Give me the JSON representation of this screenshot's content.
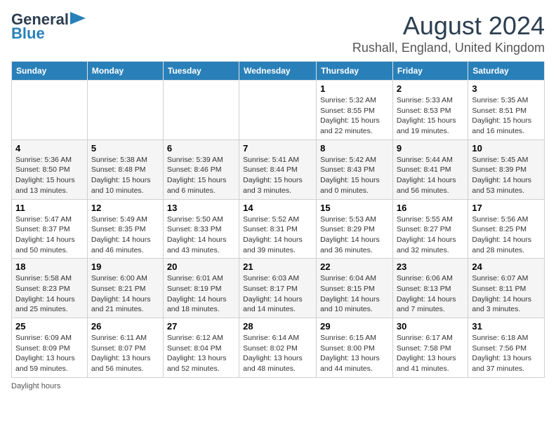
{
  "logo": {
    "line1": "General",
    "line2": "Blue"
  },
  "title": "August 2024",
  "subtitle": "Rushall, England, United Kingdom",
  "days_of_week": [
    "Sunday",
    "Monday",
    "Tuesday",
    "Wednesday",
    "Thursday",
    "Friday",
    "Saturday"
  ],
  "weeks": [
    [
      {
        "num": "",
        "info": ""
      },
      {
        "num": "",
        "info": ""
      },
      {
        "num": "",
        "info": ""
      },
      {
        "num": "",
        "info": ""
      },
      {
        "num": "1",
        "info": "Sunrise: 5:32 AM\nSunset: 8:55 PM\nDaylight: 15 hours and 22 minutes."
      },
      {
        "num": "2",
        "info": "Sunrise: 5:33 AM\nSunset: 8:53 PM\nDaylight: 15 hours and 19 minutes."
      },
      {
        "num": "3",
        "info": "Sunrise: 5:35 AM\nSunset: 8:51 PM\nDaylight: 15 hours and 16 minutes."
      }
    ],
    [
      {
        "num": "4",
        "info": "Sunrise: 5:36 AM\nSunset: 8:50 PM\nDaylight: 15 hours and 13 minutes."
      },
      {
        "num": "5",
        "info": "Sunrise: 5:38 AM\nSunset: 8:48 PM\nDaylight: 15 hours and 10 minutes."
      },
      {
        "num": "6",
        "info": "Sunrise: 5:39 AM\nSunset: 8:46 PM\nDaylight: 15 hours and 6 minutes."
      },
      {
        "num": "7",
        "info": "Sunrise: 5:41 AM\nSunset: 8:44 PM\nDaylight: 15 hours and 3 minutes."
      },
      {
        "num": "8",
        "info": "Sunrise: 5:42 AM\nSunset: 8:43 PM\nDaylight: 15 hours and 0 minutes."
      },
      {
        "num": "9",
        "info": "Sunrise: 5:44 AM\nSunset: 8:41 PM\nDaylight: 14 hours and 56 minutes."
      },
      {
        "num": "10",
        "info": "Sunrise: 5:45 AM\nSunset: 8:39 PM\nDaylight: 14 hours and 53 minutes."
      }
    ],
    [
      {
        "num": "11",
        "info": "Sunrise: 5:47 AM\nSunset: 8:37 PM\nDaylight: 14 hours and 50 minutes."
      },
      {
        "num": "12",
        "info": "Sunrise: 5:49 AM\nSunset: 8:35 PM\nDaylight: 14 hours and 46 minutes."
      },
      {
        "num": "13",
        "info": "Sunrise: 5:50 AM\nSunset: 8:33 PM\nDaylight: 14 hours and 43 minutes."
      },
      {
        "num": "14",
        "info": "Sunrise: 5:52 AM\nSunset: 8:31 PM\nDaylight: 14 hours and 39 minutes."
      },
      {
        "num": "15",
        "info": "Sunrise: 5:53 AM\nSunset: 8:29 PM\nDaylight: 14 hours and 36 minutes."
      },
      {
        "num": "16",
        "info": "Sunrise: 5:55 AM\nSunset: 8:27 PM\nDaylight: 14 hours and 32 minutes."
      },
      {
        "num": "17",
        "info": "Sunrise: 5:56 AM\nSunset: 8:25 PM\nDaylight: 14 hours and 28 minutes."
      }
    ],
    [
      {
        "num": "18",
        "info": "Sunrise: 5:58 AM\nSunset: 8:23 PM\nDaylight: 14 hours and 25 minutes."
      },
      {
        "num": "19",
        "info": "Sunrise: 6:00 AM\nSunset: 8:21 PM\nDaylight: 14 hours and 21 minutes."
      },
      {
        "num": "20",
        "info": "Sunrise: 6:01 AM\nSunset: 8:19 PM\nDaylight: 14 hours and 18 minutes."
      },
      {
        "num": "21",
        "info": "Sunrise: 6:03 AM\nSunset: 8:17 PM\nDaylight: 14 hours and 14 minutes."
      },
      {
        "num": "22",
        "info": "Sunrise: 6:04 AM\nSunset: 8:15 PM\nDaylight: 14 hours and 10 minutes."
      },
      {
        "num": "23",
        "info": "Sunrise: 6:06 AM\nSunset: 8:13 PM\nDaylight: 14 hours and 7 minutes."
      },
      {
        "num": "24",
        "info": "Sunrise: 6:07 AM\nSunset: 8:11 PM\nDaylight: 14 hours and 3 minutes."
      }
    ],
    [
      {
        "num": "25",
        "info": "Sunrise: 6:09 AM\nSunset: 8:09 PM\nDaylight: 13 hours and 59 minutes."
      },
      {
        "num": "26",
        "info": "Sunrise: 6:11 AM\nSunset: 8:07 PM\nDaylight: 13 hours and 56 minutes."
      },
      {
        "num": "27",
        "info": "Sunrise: 6:12 AM\nSunset: 8:04 PM\nDaylight: 13 hours and 52 minutes."
      },
      {
        "num": "28",
        "info": "Sunrise: 6:14 AM\nSunset: 8:02 PM\nDaylight: 13 hours and 48 minutes."
      },
      {
        "num": "29",
        "info": "Sunrise: 6:15 AM\nSunset: 8:00 PM\nDaylight: 13 hours and 44 minutes."
      },
      {
        "num": "30",
        "info": "Sunrise: 6:17 AM\nSunset: 7:58 PM\nDaylight: 13 hours and 41 minutes."
      },
      {
        "num": "31",
        "info": "Sunrise: 6:18 AM\nSunset: 7:56 PM\nDaylight: 13 hours and 37 minutes."
      }
    ]
  ],
  "footer": "Daylight hours"
}
